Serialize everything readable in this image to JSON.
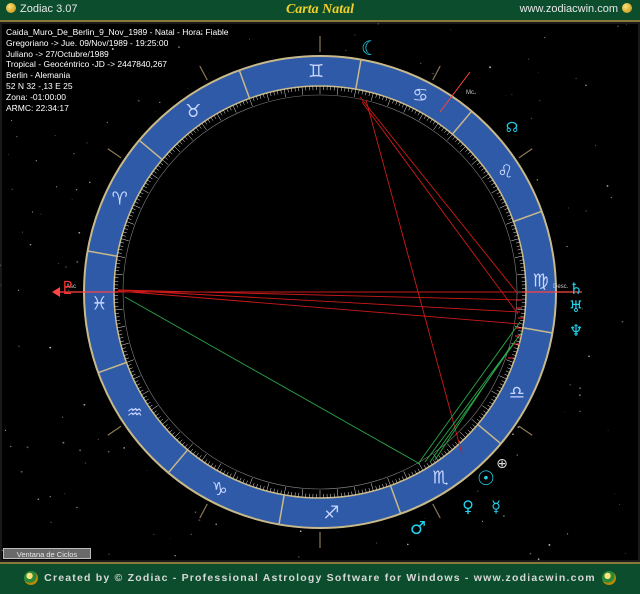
{
  "window": {
    "app_name": "Zodiac 3.07",
    "title": "Carta Natal",
    "website": "www.zodiacwin.com"
  },
  "info_lines": [
    "Caida_Muro_De_Berlin_9_Nov_1989 - Natal - Hora: Fiable",
    "Gregoriano -> Jue. 09/Nov/1989 - 19:25:00",
    "Juliano -> 27/Octubre/1989",
    "Tropical - Geocéntrico -JD -> 2447840,267",
    "Berlin - Alemania",
    "52 N 32 - 13 E 25",
    "Zona: -01:00:00",
    "ARMC: 22:34:17"
  ],
  "chart_data": {
    "type": "astrology-wheel",
    "axis_labels": {
      "asc": "Asc",
      "mc": "Mc.",
      "desc": "Desc."
    },
    "signs": [
      {
        "name": "aries",
        "glyph": "♈"
      },
      {
        "name": "taurus",
        "glyph": "♉"
      },
      {
        "name": "gemini",
        "glyph": "♊"
      },
      {
        "name": "cancer",
        "glyph": "♋"
      },
      {
        "name": "leo",
        "glyph": "♌"
      },
      {
        "name": "virgo",
        "glyph": "♍"
      },
      {
        "name": "libra",
        "glyph": "♎"
      },
      {
        "name": "scorpio",
        "glyph": "♏"
      },
      {
        "name": "sagittarius",
        "glyph": "♐"
      },
      {
        "name": "capricorn",
        "glyph": "♑"
      },
      {
        "name": "aquarius",
        "glyph": "♒"
      },
      {
        "name": "pisces",
        "glyph": "♓"
      }
    ],
    "planets": [
      {
        "name": "moon",
        "glyph": "☾",
        "color": "#22d3ee"
      },
      {
        "name": "north-node",
        "glyph": "☊",
        "color": "#22d3ee"
      },
      {
        "name": "saturn",
        "glyph": "♄",
        "color": "#22d3ee"
      },
      {
        "name": "uranus",
        "glyph": "♅",
        "color": "#22d3ee"
      },
      {
        "name": "neptune",
        "glyph": "♆",
        "color": "#22d3ee"
      },
      {
        "name": "pluto",
        "glyph": "♇",
        "color": "#ff3333"
      },
      {
        "name": "sun",
        "glyph": "☉",
        "color": "#22d3ee"
      },
      {
        "name": "venus",
        "glyph": "♀",
        "color": "#22d3ee"
      },
      {
        "name": "mercury",
        "glyph": "☿",
        "color": "#22d3ee"
      },
      {
        "name": "mars",
        "glyph": "♂",
        "color": "#22d3ee"
      },
      {
        "name": "part-of-fortune",
        "glyph": "⊕",
        "color": "#dddddd"
      }
    ],
    "colors": {
      "ring": "#2e5aa8",
      "ring_border": "#c8b98a",
      "house_lines": "#8a7a5a",
      "red_aspect": "#cc1a1a",
      "green_aspect": "#2aa84a"
    }
  },
  "buttons": {
    "ciclos": "Ventana de Ciclos"
  },
  "footer": {
    "text": "Created by © Zodiac - Professional Astrology Software for Windows - www.zodiacwin.com"
  }
}
